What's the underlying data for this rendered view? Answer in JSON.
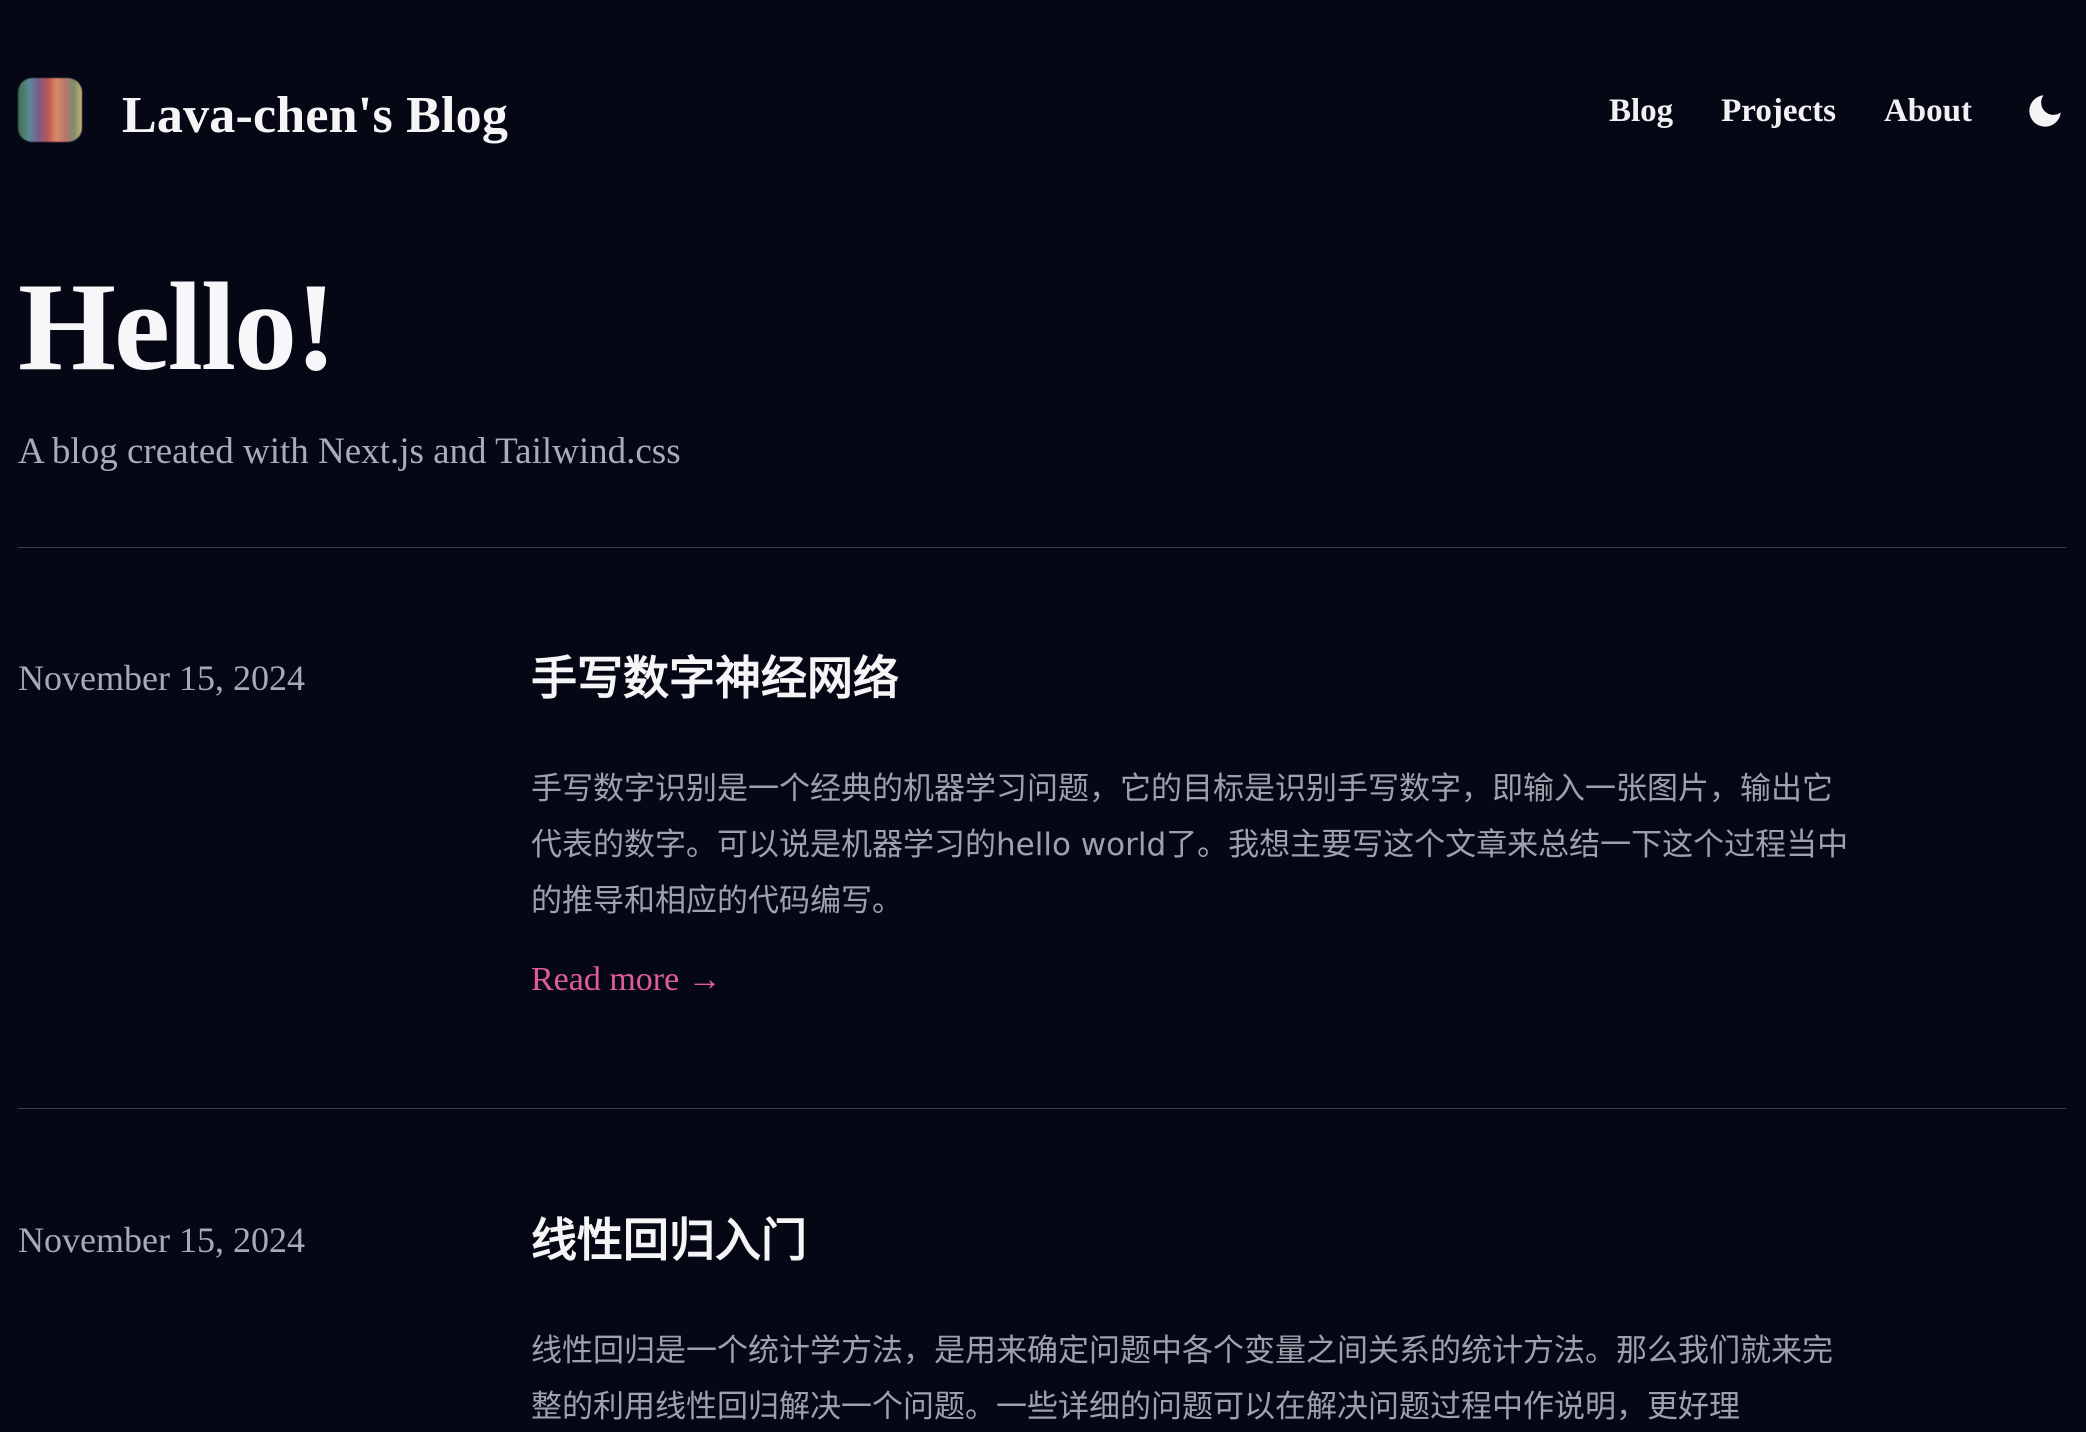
{
  "header": {
    "site_title": "Lava-chen's Blog",
    "nav": [
      {
        "label": "Blog"
      },
      {
        "label": "Projects"
      },
      {
        "label": "About"
      }
    ],
    "theme_toggle_icon": "moon-icon"
  },
  "hero": {
    "title": "Hello!",
    "subtitle": "A blog created with Next.js and Tailwind.css"
  },
  "posts": [
    {
      "date": "November 15, 2024",
      "title": "手写数字神经网络",
      "excerpt": "手写数字识别是一个经典的机器学习问题，它的目标是识别手写数字，即输入一张图片，输出它代表的数字。可以说是机器学习的hello world了。我想主要写这个文章来总结一下这个过程当中的推导和相应的代码编写。",
      "read_more": "Read more →"
    },
    {
      "date": "November 15, 2024",
      "title": "线性回归入门",
      "excerpt": "线性回归是一个统计学方法，是用来确定问题中各个变量之间关系的统计方法。那么我们就来完整的利用线性回归解决一个问题。一些详细的问题可以在解决问题过程中作说明，更好理"
    }
  ],
  "colors": {
    "background": "#050714",
    "accent": "#e05b9a",
    "muted_text": "#a7aab4",
    "divider": "#3a3d4a"
  }
}
